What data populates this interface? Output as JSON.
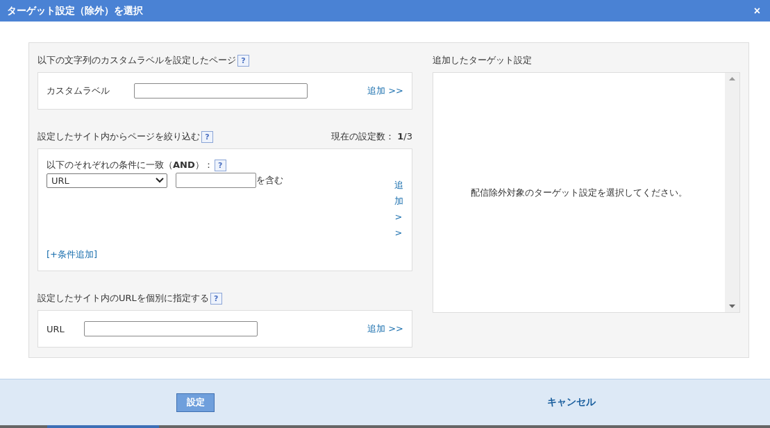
{
  "window": {
    "title": "ターゲット設定（除外）を選択",
    "close": "×"
  },
  "custom_label_section": {
    "heading": "以下の文字列のカスタムラベルを設定したページ",
    "help": "?",
    "field_label": "カスタムラベル",
    "add_link": "追加 >>"
  },
  "filter_section": {
    "heading": "設定したサイト内からページを絞り込む",
    "help": "?",
    "count_label": "現在の設定数：",
    "count": "**1**/3",
    "condition_heading": "以下のそれぞれの条件に一致（**AND**）：",
    "condition_help": "?",
    "condition": {
      "select_value": "URL",
      "suffix": "を含む"
    },
    "add_link": "追加 >>",
    "add_condition": "[+条件追加]"
  },
  "url_section": {
    "heading": "設定したサイト内のURLを個別に指定する",
    "help": "?",
    "field_label": "URL",
    "add_link": "追加 >>"
  },
  "added_targets": {
    "heading": "追加したターゲット設定",
    "empty_message": "配信除外対象のターゲット設定を選択してください。"
  },
  "buttons": [
    {
      "label": "設定",
      "kind": "primary"
    },
    {
      "label": "キャンセル",
      "kind": "link"
    }
  ]
}
